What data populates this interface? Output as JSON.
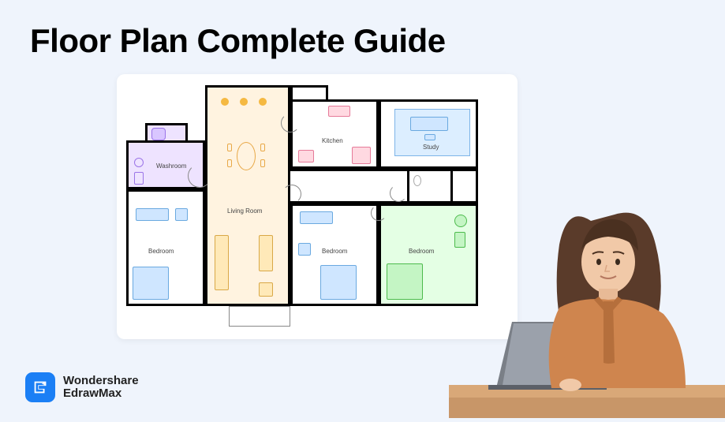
{
  "title": "Floor Plan Complete Guide",
  "brand": {
    "line1": "Wondershare",
    "line2": "EdrawMax"
  },
  "floorplan": {
    "rooms": {
      "washroom": "Washroom",
      "livingroom": "Living Room",
      "kitchen": "Kitchen",
      "study": "Study",
      "bed1": "Bedroom",
      "bed2": "Bedroom",
      "bed3": "Bedroom"
    },
    "colors": {
      "washroom": "#eee3ff",
      "livingroom": "#fff3e0",
      "study": "#dceeff",
      "bed3": "#e4ffe4",
      "bed_blue": "#cfe6ff",
      "bed_green": "#c4f5c4",
      "accent_orange": "#f5b942",
      "accent_pink": "#ffd9e1"
    }
  }
}
